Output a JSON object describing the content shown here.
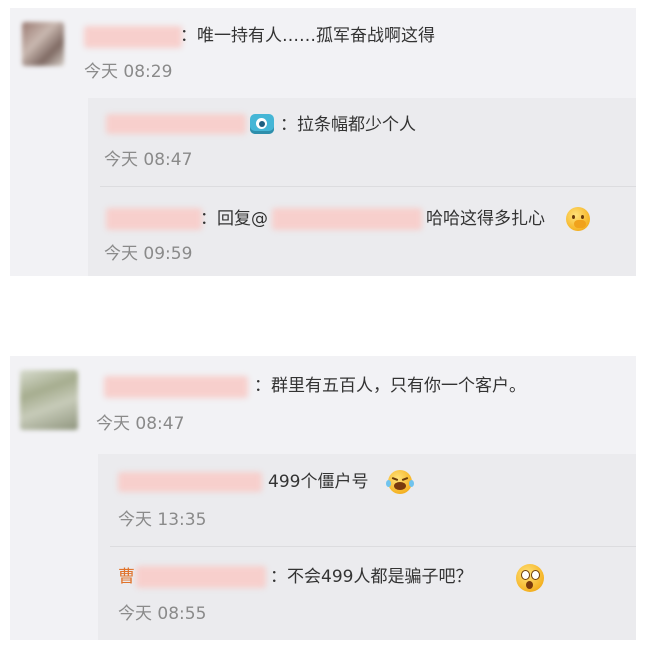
{
  "thread1": {
    "comment": {
      "text": "：唯一持有人……孤军奋战啊这得",
      "time": "今天 08:29"
    },
    "replies": [
      {
        "text": "：拉条幅都少个人",
        "time": "今天 08:47",
        "icon": "camera-icon"
      },
      {
        "prefix": "：回复@",
        "text": "哈哈这得多扎心",
        "time": "今天 09:59",
        "icon": "hand-over-mouth-emoji-icon"
      }
    ]
  },
  "thread2": {
    "comment": {
      "text": "：群里有五百人，只有你一个客户。",
      "time": "今天 08:47"
    },
    "replies": [
      {
        "text": "499个僵户号",
        "time": "今天 13:35",
        "icon": "laughing-tears-emoji-icon"
      },
      {
        "prefix": "曹",
        "text": "：不会499人都是骗子吧？",
        "time": "今天 08:55",
        "icon": "shocked-face-emoji-icon"
      }
    ]
  }
}
